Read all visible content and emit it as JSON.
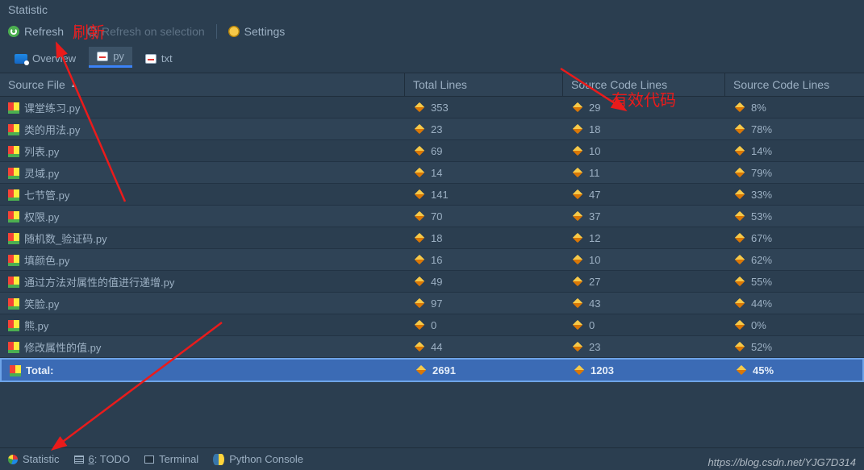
{
  "title": "Statistic",
  "toolbar": {
    "refresh": "Refresh",
    "refresh_on_selection": "Refresh on selection",
    "settings": "Settings"
  },
  "tabs": {
    "overview": "Overview",
    "py": "py",
    "txt": "txt"
  },
  "columns": {
    "source_file": "Source File",
    "total_lines": "Total Lines",
    "source_code_lines": "Source Code Lines",
    "source_code_lines_pct": "Source Code Lines"
  },
  "rows": [
    {
      "name": "课堂练习.py",
      "total": "353",
      "code": "29",
      "pct": "8%"
    },
    {
      "name": "类的用法.py",
      "total": "23",
      "code": "18",
      "pct": "78%"
    },
    {
      "name": "列表.py",
      "total": "69",
      "code": "10",
      "pct": "14%"
    },
    {
      "name": "灵域.py",
      "total": "14",
      "code": "11",
      "pct": "79%"
    },
    {
      "name": "七节管.py",
      "total": "141",
      "code": "47",
      "pct": "33%"
    },
    {
      "name": "权限.py",
      "total": "70",
      "code": "37",
      "pct": "53%"
    },
    {
      "name": "随机数_验证码.py",
      "total": "18",
      "code": "12",
      "pct": "67%"
    },
    {
      "name": "填颜色.py",
      "total": "16",
      "code": "10",
      "pct": "62%"
    },
    {
      "name": "通过方法对属性的值进行递增.py",
      "total": "49",
      "code": "27",
      "pct": "55%"
    },
    {
      "name": "笑脸.py",
      "total": "97",
      "code": "43",
      "pct": "44%"
    },
    {
      "name": "熊.py",
      "total": "0",
      "code": "0",
      "pct": "0%"
    },
    {
      "name": "修改属性的值.py",
      "total": "44",
      "code": "23",
      "pct": "52%"
    }
  ],
  "total": {
    "label": "Total:",
    "total_lines": "2691",
    "code_lines": "1203",
    "pct": "45%"
  },
  "bottom": {
    "statistic": "Statistic",
    "todo_prefix": "6",
    "todo": ": TODO",
    "terminal": "Terminal",
    "python_console": "Python Console"
  },
  "annotations": {
    "refresh_cn": "刷新",
    "effective_code_cn": "有效代码"
  },
  "watermark": "https://blog.csdn.net/YJG7D314"
}
